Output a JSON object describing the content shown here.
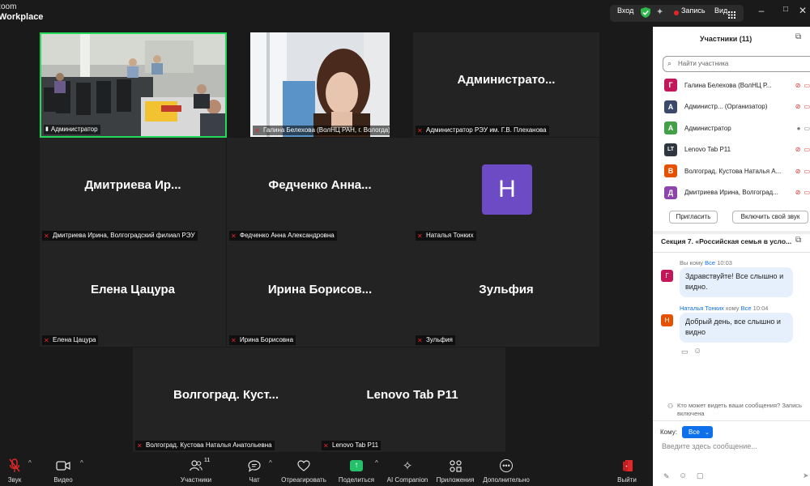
{
  "titlebar": {
    "brand_line1": "zoom",
    "brand_line2": "Workplace",
    "signin": "Вход",
    "record": "Запись",
    "view": "Вид"
  },
  "tiles": [
    {
      "name": "",
      "label": "Администратор",
      "type": "video-room",
      "label_icon": "pin-icon"
    },
    {
      "name": "",
      "label": "Галина Белехова (ВолНЦ РАН, г. Вологда)",
      "type": "video-person",
      "label_icon": "mic-off-icon"
    },
    {
      "name": "Администрато...",
      "label": "Администратор РЭУ им. Г.В. Плеханова",
      "type": "name",
      "label_icon": "mic-off-icon"
    },
    {
      "name": "Дмитриева Ир...",
      "label": "Дмитриева Ирина, Волгоградский филиал РЭУ",
      "type": "name",
      "label_icon": "mic-off-icon"
    },
    {
      "name": "Федченко Анна...",
      "label": "Федченко Анна Александровна",
      "type": "name",
      "label_icon": "mic-off-icon"
    },
    {
      "name": "H",
      "label": "Наталья Тонких",
      "type": "avatar",
      "label_icon": "mic-off-icon"
    },
    {
      "name": "Елена Цацура",
      "label": "Елена Цацура",
      "type": "name",
      "label_icon": "mic-off-icon"
    },
    {
      "name": "Ирина Борисов...",
      "label": "Ирина Борисовна",
      "type": "name",
      "label_icon": "mic-off-icon"
    },
    {
      "name": "Зульфия",
      "label": "Зульфия",
      "type": "name",
      "label_icon": "mic-off-icon"
    },
    {
      "name": "Волгоград. Куст...",
      "label": "Волгоград. Кустова Наталья Анатольевна",
      "type": "name",
      "label_icon": "mic-off-icon"
    },
    {
      "name": "Lenovo Tab P11",
      "label": "Lenovo Tab P11",
      "type": "name",
      "label_icon": "mic-off-icon"
    }
  ],
  "toolbar": {
    "audio": "Звук",
    "video": "Видео",
    "participants": "Участники",
    "participants_count": "11",
    "chat": "Чат",
    "react": "Отреагировать",
    "share": "Поделиться",
    "ai": "AI Companion",
    "apps": "Приложения",
    "more": "Дополнительно",
    "leave": "Выйти"
  },
  "participants_panel": {
    "title": "Участники (11)",
    "search_placeholder": "Найти участника",
    "items": [
      {
        "initial": "Г",
        "name": "Галина Белехова (ВолНЦ Р...",
        "color": "#c2185b"
      },
      {
        "initial": "А",
        "name": "Администр... (Организатор)",
        "color": "#3b4a6b"
      },
      {
        "initial": "А",
        "name": "Администратор",
        "color": "#43a047"
      },
      {
        "initial": "LT",
        "name": "Lenovo Tab P11",
        "color": "#2f3640"
      },
      {
        "initial": "В",
        "name": "Волгоград. Кустова Наталья А...",
        "color": "#e65100"
      },
      {
        "initial": "Д",
        "name": "Дмитриева Ирина, Волгоград...",
        "color": "#8e44ad"
      }
    ],
    "invite": "Пригласить",
    "unmute": "Включить свой звук"
  },
  "chat_panel": {
    "title": "Секция 7. «Российская семья в усло...",
    "messages": [
      {
        "sender": "Вы",
        "to_word": "кому",
        "to": "Все",
        "time": "10:03",
        "initial": "Г",
        "color": "#c2185b",
        "text": "Здравствуйте! Все слышно и видно."
      },
      {
        "sender": "Наталья Тонких",
        "to_word": "кому",
        "to": "Все",
        "time": "10:04",
        "initial": "Н",
        "color": "#e65100",
        "text": "Добрый день, все слышно и видно"
      }
    ],
    "notice": "Кто может видеть ваши сообщения? Запись включена",
    "to_label": "Кому:",
    "to_value": "Все",
    "input_placeholder": "Введите здесь сообщение..."
  },
  "colors": {
    "accent": "#0e71eb",
    "active_border": "#23d959",
    "mic_off": "#e02828",
    "avatar_tile": "#6d4bc4"
  }
}
